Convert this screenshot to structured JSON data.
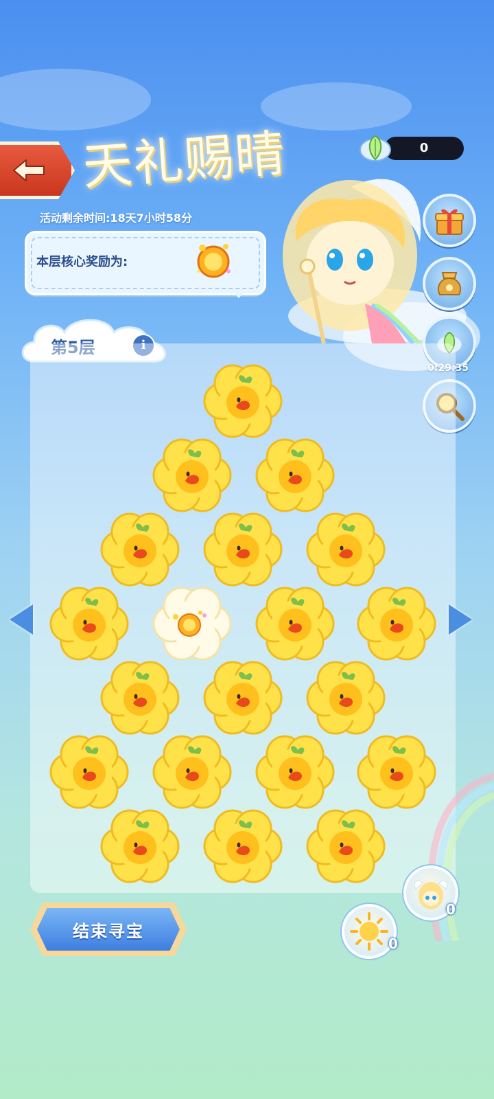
{
  "title": "天礼赐晴",
  "timer": "活动剩余时间:18天7小时58分",
  "reward": {
    "label": "本层核心奖励为:"
  },
  "currency": {
    "value": "0"
  },
  "side": {
    "timer": "0:29:35"
  },
  "floor": {
    "label": "第5层",
    "info": "i"
  },
  "board": {
    "rows": [
      [
        "flower"
      ],
      [
        "flower",
        "flower"
      ],
      [
        "flower",
        "flower",
        "flower"
      ],
      [
        "flower",
        "core-reward",
        "flower",
        "flower"
      ],
      [
        "flower",
        "flower",
        "flower"
      ],
      [
        "flower",
        "flower",
        "flower",
        "flower"
      ],
      [
        "flower",
        "flower",
        "flower"
      ]
    ]
  },
  "end_button": {
    "label": "结束寻宝"
  },
  "counters": {
    "sun_count": "0",
    "angel_count": "0"
  },
  "colors": {
    "accent": "#3e7fe0",
    "flower": "#ffe24a",
    "back": "#d9432a"
  },
  "icons": [
    "back-arrow-icon",
    "feather-gem-icon",
    "gift-box-icon",
    "treasure-bag-icon",
    "magnifier-icon",
    "info-icon",
    "sun-coin-icon",
    "angel-icon"
  ]
}
